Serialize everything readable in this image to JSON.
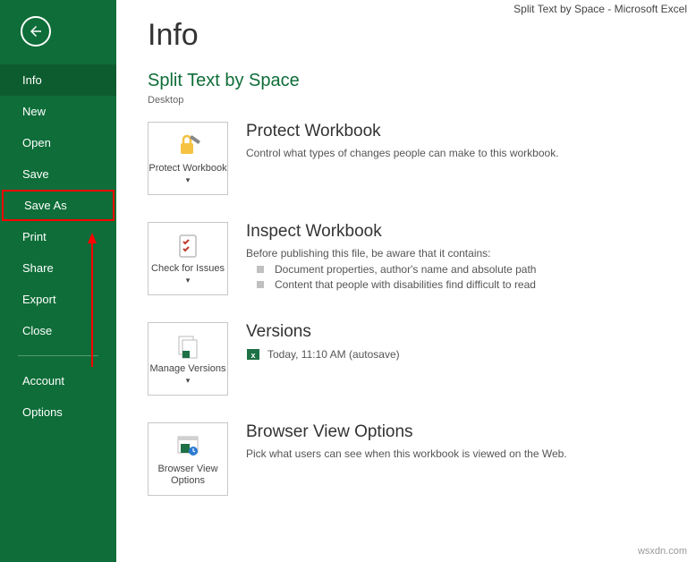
{
  "titlebar": "Split Text by Space - Microsoft Excel",
  "sidebar": {
    "items": [
      {
        "label": "Info",
        "active": true
      },
      {
        "label": "New"
      },
      {
        "label": "Open"
      },
      {
        "label": "Save"
      },
      {
        "label": "Save As",
        "highlight": true
      },
      {
        "label": "Print"
      },
      {
        "label": "Share"
      },
      {
        "label": "Export"
      },
      {
        "label": "Close"
      }
    ],
    "footer": [
      {
        "label": "Account"
      },
      {
        "label": "Options"
      }
    ]
  },
  "main": {
    "pageTitle": "Info",
    "docTitle": "Split Text by Space",
    "docPath": "Desktop",
    "sections": {
      "protect": {
        "title": "Protect Workbook",
        "desc": "Control what types of changes people can make to this workbook.",
        "tileLabel": "Protect Workbook"
      },
      "inspect": {
        "title": "Inspect Workbook",
        "desc": "Before publishing this file, be aware that it contains:",
        "bullets": [
          "Document properties, author's name and absolute path",
          "Content that people with disabilities find difficult to read"
        ],
        "tileLabel": "Check for Issues"
      },
      "versions": {
        "title": "Versions",
        "entry": "Today, 11:10 AM (autosave)",
        "tileLabel": "Manage Versions"
      },
      "browser": {
        "title": "Browser View Options",
        "desc": "Pick what users can see when this workbook is viewed on the Web.",
        "tileLabel": "Browser View Options"
      }
    }
  },
  "watermark": "wsxdn.com"
}
